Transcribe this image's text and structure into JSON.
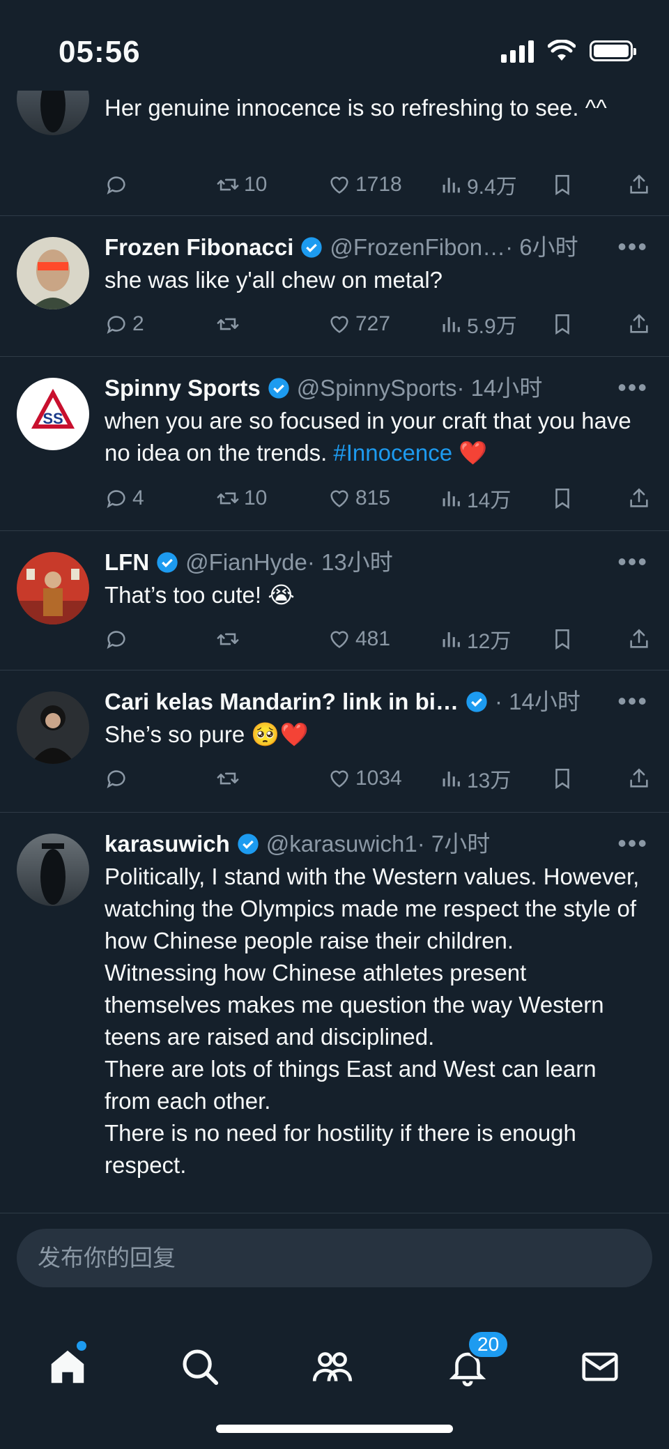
{
  "status_bar": {
    "time": "05:56"
  },
  "tweets": [
    {
      "id": "t0",
      "body": "Her genuine innocence is so refreshing to see. ^^",
      "replies": "",
      "retweets": "10",
      "likes": "1718",
      "views": "9.4万"
    },
    {
      "id": "t1",
      "name": "Frozen Fibonacci",
      "handle": "@FrozenFibon…",
      "time": "· 6小时",
      "body": "she was like y'all chew on metal?",
      "replies": "2",
      "retweets": "",
      "likes": "727",
      "views": "5.9万"
    },
    {
      "id": "t2",
      "name": "Spinny Sports",
      "handle": "@SpinnySports",
      "time": "· 14小时",
      "body_pre": "when you are so focused in your craft that you have no idea on the trends. ",
      "hashtag": "#Innocence",
      "emoji": "❤️",
      "replies": "4",
      "retweets": "10",
      "likes": "815",
      "views": "14万"
    },
    {
      "id": "t3",
      "name": "LFN",
      "handle": "@FianHyde",
      "time": "· 13小时",
      "body": "That’s too cute! 😭",
      "replies": "",
      "retweets": "",
      "likes": "481",
      "views": "12万"
    },
    {
      "id": "t4",
      "name": "Cari kelas Mandarin? link in bi…",
      "handle": "",
      "time": "· 14小时",
      "body": "She’s so pure 🥺❤️",
      "replies": "",
      "retweets": "",
      "likes": "1034",
      "views": "13万"
    },
    {
      "id": "t5",
      "name": "karasuwich",
      "handle": "@karasuwich1",
      "time": "· 7小时",
      "lines": [
        "Politically, I stand with the Western values. However, watching the Olympics made me respect the style of how Chinese people raise their children.",
        "Witnessing how Chinese athletes present themselves makes me question the way Western teens are raised and disciplined.",
        "There are lots of things East and West can learn from each other.",
        "There is no need for hostility if there is enough respect."
      ]
    }
  ],
  "reply": {
    "placeholder": "发布你的回复"
  },
  "nav": {
    "notification_count": "20"
  },
  "colors": {
    "background": "#15202b",
    "accent": "#1d9bf0",
    "muted": "#8b98a5",
    "heart": "#e0245e"
  }
}
